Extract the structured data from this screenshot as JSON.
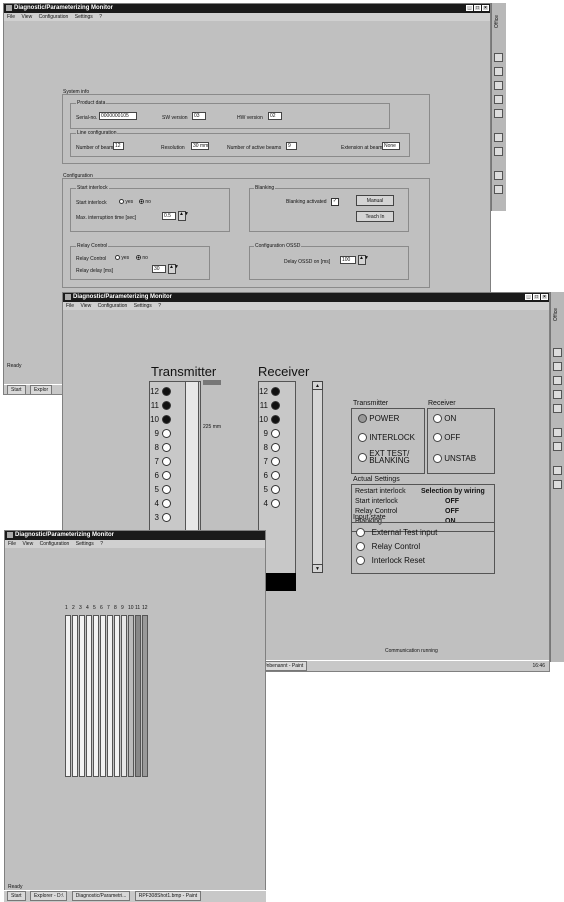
{
  "app_title": "Diagnostic/Parameterizing Monitor",
  "window_buttons": [
    "_",
    "□",
    "×"
  ],
  "menu": [
    "File",
    "View",
    "Configuration",
    "Settings",
    "?"
  ],
  "office_label": "Office",
  "window1": {
    "system_info": "System info",
    "product_data": "Product data",
    "serial_label": "Serial-no.",
    "serial_value": "0000000105",
    "sw_label": "SW version",
    "sw_value": "03",
    "hw_label": "HW version",
    "hw_value": "02",
    "line_config": "Line configuration",
    "beams_label": "Number of beams",
    "beams_value": "12",
    "resolution_label": "Resolution",
    "resolution_value": "30 mm",
    "active_beams_label": "Number of active beams",
    "active_beams_value": "9",
    "extension_label": "Extension at beam",
    "extension_value": "None",
    "configuration": "Configuration",
    "start_interlock_group": "Start interlock",
    "start_interlock_label": "Start interlock",
    "yes": "yes",
    "no": "no",
    "max_interruption_label": "Max. interruption time [sec]",
    "max_interruption_value": "0.5",
    "blanking_group": "Blanking",
    "blanking_activated_label": "Blanking activated",
    "manual_btn": "Manual",
    "teach_btn": "Teach In",
    "relay_group": "Relay Control",
    "relay_control_label": "Relay Control",
    "relay_delay_label": "Relay delay [ms]",
    "relay_delay_value": "30",
    "config_ossd_group": "Configuration OSSD",
    "delay_ossd_label": "Delay OSSD on [ms]",
    "delay_ossd_value": "100",
    "status": "Ready",
    "taskbar": [
      "Start",
      "Explor"
    ]
  },
  "window2": {
    "transmitter": "Transmitter",
    "receiver": "Receiver",
    "transmitter_beams": [
      {
        "n": "12",
        "on": true
      },
      {
        "n": "11",
        "on": true
      },
      {
        "n": "10",
        "on": true
      },
      {
        "n": "9",
        "on": false
      },
      {
        "n": "8",
        "on": false
      },
      {
        "n": "7",
        "on": false
      },
      {
        "n": "6",
        "on": false
      },
      {
        "n": "5",
        "on": false
      },
      {
        "n": "4",
        "on": false
      },
      {
        "n": "3",
        "on": false
      }
    ],
    "receiver_beams": [
      {
        "n": "12",
        "on": true
      },
      {
        "n": "11",
        "on": true
      },
      {
        "n": "10",
        "on": true
      },
      {
        "n": "9",
        "on": false
      },
      {
        "n": "8",
        "on": false
      },
      {
        "n": "7",
        "on": false
      },
      {
        "n": "6",
        "on": false
      },
      {
        "n": "5",
        "on": false
      },
      {
        "n": "4",
        "on": false
      }
    ],
    "dim_label": "225 mm",
    "transmitter_col_label": "Transmitter",
    "receiver_col_label": "Receiver",
    "power": "POWER",
    "interlock": "INTERLOCK",
    "ext_test": "EXT TEST/\nBLANKING",
    "on": "ON",
    "off": "OFF",
    "unstab": "UNSTAB",
    "actual_settings": "Actual Settings",
    "settings": [
      {
        "label": "Restart interlock",
        "value": "Selection by wiring"
      },
      {
        "label": "Start interlock",
        "value": "OFF"
      },
      {
        "label": "Relay Control",
        "value": "OFF"
      },
      {
        "label": "Blanking",
        "value": "ON"
      }
    ],
    "input_state": "Input state",
    "inputs": [
      "External Test input",
      "Relay Control",
      "Interlock Reset"
    ],
    "status": "Communication running",
    "taskbar_item": "Unbenannt - Paint",
    "clock": "16:46"
  },
  "window3": {
    "bar_labels": [
      "1",
      "2",
      "3",
      "4",
      "5",
      "6",
      "7",
      "8",
      "9",
      "10",
      "11",
      "12"
    ],
    "status": "Ready",
    "taskbar": [
      "Start",
      "Explorer - D:\\",
      "Diagnostic/Parametri...",
      "RPF308Shot1.bmp - Paint"
    ]
  }
}
